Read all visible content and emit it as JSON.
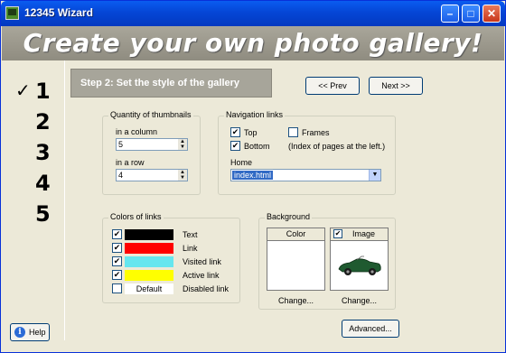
{
  "window": {
    "title": "12345 Wizard"
  },
  "banner": {
    "text": "Create your own photo gallery!"
  },
  "steps": [
    "1",
    "2",
    "3",
    "4",
    "5"
  ],
  "header": {
    "step_title": "Step 2:  Set the style of the gallery"
  },
  "nav_buttons": {
    "prev": "<< Prev",
    "next": "Next >>"
  },
  "thumbnails": {
    "legend": "Quantity of thumbnails",
    "column_label": "in a column",
    "column_value": "5",
    "row_label": "in a row",
    "row_value": "4"
  },
  "navigation": {
    "legend": "Navigation links",
    "top": {
      "label": "Top",
      "checked": true
    },
    "bottom": {
      "label": "Bottom",
      "checked": true
    },
    "frames": {
      "label": "Frames",
      "checked": false
    },
    "frames_note": "(Index of pages at the left.)",
    "home_label": "Home",
    "home_value": "index.html"
  },
  "colors": {
    "legend": "Colors of links",
    "items": [
      {
        "label": "Text",
        "color": "#000000",
        "checked": true
      },
      {
        "label": "Link",
        "color": "#ff0000",
        "checked": true
      },
      {
        "label": "Visited link",
        "color": "#66e6ef",
        "checked": true
      },
      {
        "label": "Active link",
        "color": "#ffff00",
        "checked": true
      },
      {
        "label": "Disabled link",
        "color": "#ffffff",
        "checked": false,
        "swatch_text": "Default"
      }
    ]
  },
  "background": {
    "legend": "Background",
    "color_header": "Color",
    "image_header": "Image",
    "image_checked": true,
    "change_color": "Change...",
    "change_image": "Change..."
  },
  "footer": {
    "advanced": "Advanced...",
    "help": "Help"
  }
}
